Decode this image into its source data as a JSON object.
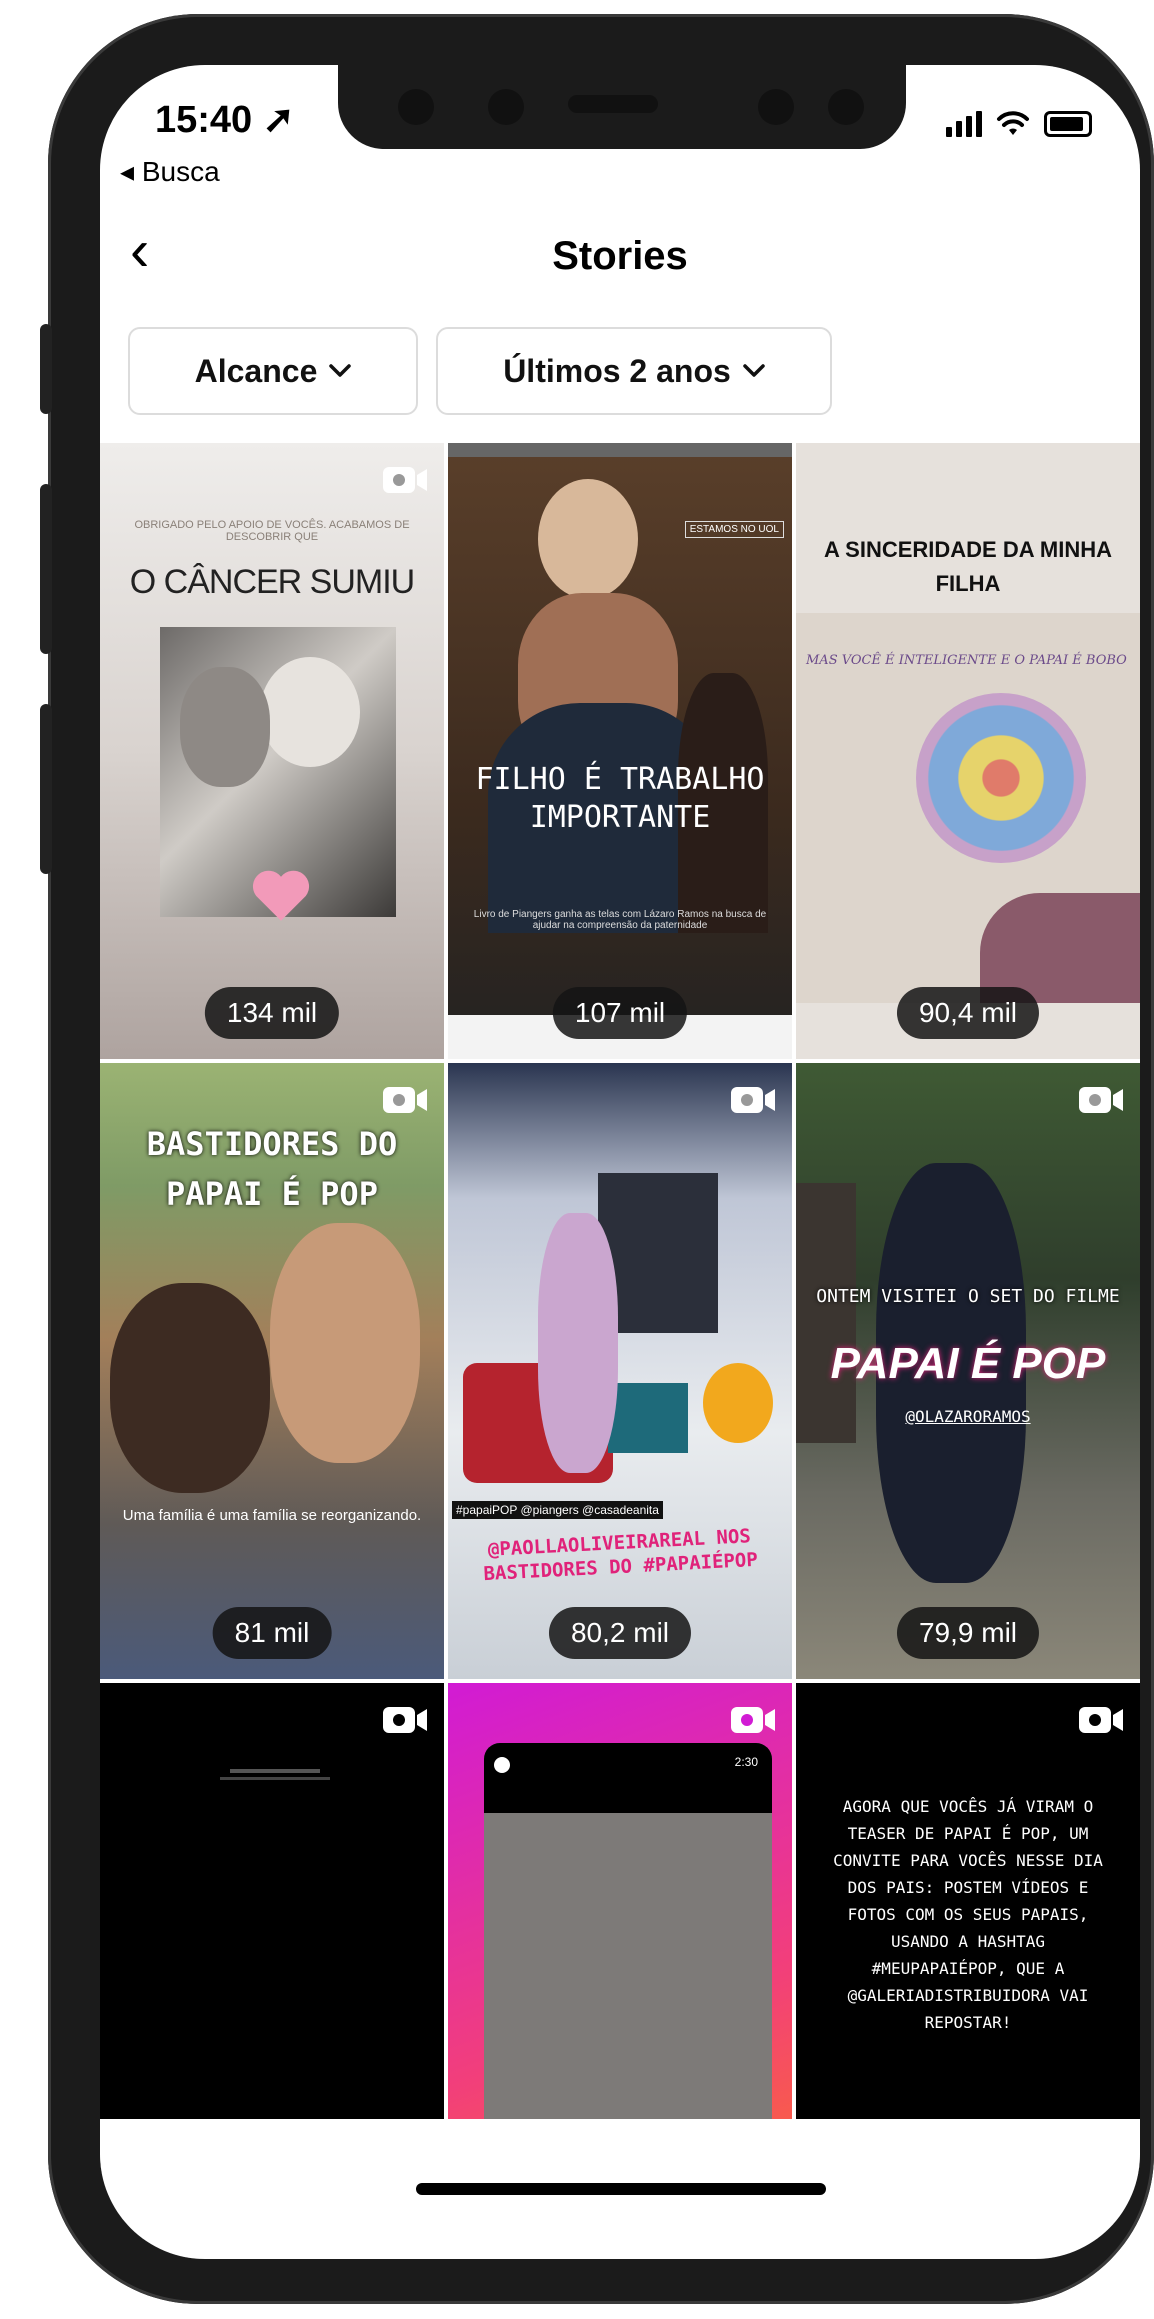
{
  "status_bar": {
    "time": "15:40 ➚",
    "back_label": "◂ Busca"
  },
  "header": {
    "back_icon": "chevron-left-icon",
    "title": "Stories"
  },
  "filters": [
    {
      "label": "Alcance",
      "icon": "chevron-down-icon"
    },
    {
      "label": "Últimos 2 anos",
      "icon": "chevron-down-icon"
    }
  ],
  "stories": [
    {
      "caption_small": "OBRIGADO PELO APOIO DE VOCÊS. ACABAMOS DE DESCOBRIR QUE",
      "caption": "O CÂNCER SUMIU",
      "reach": "134 mil",
      "video": true
    },
    {
      "caption_tag": "ESTAMOS NO UOL",
      "caption": "FILHO É TRABALHO IMPORTANTE",
      "caption_small": "Livro de Piangers ganha as telas com Lázaro Ramos na busca de ajudar na compreensão da paternidade",
      "reach": "107 mil",
      "video": false
    },
    {
      "caption": "A SINCERIDADE DA MINHA FILHA",
      "caption_note": "MAS VOCÊ É INTELIGENTE E O PAPAI É BOBO",
      "reach": "90,4 mil",
      "video": false
    },
    {
      "caption": "BASTIDORES DO PAPAI É POP",
      "caption_small": "Uma família é uma família se reorganizando.",
      "reach": "81 mil",
      "video": true
    },
    {
      "caption_tag": "#papaiPOP @piangers @casadeanita",
      "caption": "@PAOLLAOLIVEIRAREAL NOS BASTIDORES DO #PAPAIÉPOP",
      "reach": "80,2 mil",
      "video": true
    },
    {
      "caption_small": "ONTEM VISITEI O SET DO FILME",
      "caption": "PAPAI É POP",
      "caption_tag": "@OLAZARORAMOS",
      "reach": "79,9 mil",
      "video": true
    },
    {
      "caption": "",
      "reach": "",
      "video": true
    },
    {
      "caption_tag": "2:30",
      "caption": "",
      "reach": "",
      "video": true
    },
    {
      "caption": "AGORA QUE VOCÊS JÁ VIRAM O TEASER DE PAPAI É POP, UM CONVITE PARA VOCÊS NESSE DIA DOS PAIS: POSTEM VÍDEOS E FOTOS COM OS SEUS PAPAIS, USANDO A HASHTAG #MEUPAPAIÉPOP, QUE A @GALERIADISTRIBUIDORA VAI REPOSTAR!",
      "reach": "",
      "video": true
    }
  ]
}
